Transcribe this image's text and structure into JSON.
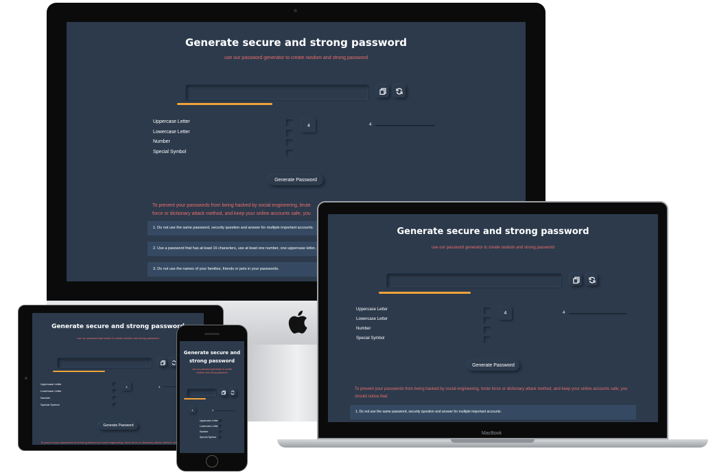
{
  "devices": {
    "imac": {
      "label": "iMac"
    },
    "macbook": {
      "label": "MacBook"
    },
    "ipad": {
      "label": "iPad"
    },
    "iphone": {
      "label": "iPhone"
    }
  },
  "app": {
    "title": "Generate secure and strong password",
    "subtitle": "use our password generator to create random and strong password",
    "password_value": "",
    "options": [
      {
        "label": "Uppercase Letter"
      },
      {
        "label": "Lowercase Letter"
      },
      {
        "label": "Number"
      },
      {
        "label": "Special Symbol"
      }
    ],
    "length_value": "4",
    "slider_value": "4",
    "generate_button": "Generate Password",
    "warning": "To prevent your passwords from being hacked by social engineering, brute force or dictionary attack method, and keep your online accounts safe, you should notice that:",
    "warning_imac": "To prevent your passwords from being hacked by social engineering, brute force or dictionary attack method, and keep your online accounts safe, you should notice that:",
    "tips": [
      "1. Do not use the same password, security question and answer for multiple important accounts.",
      "2. Use a password that has at least 16 characters, use at least one number, one uppercase letter, one lowercase letter and one special symbol.",
      "3. Do not use the names of your families, friends or pets in your passwords."
    ],
    "strength_fraction": 0.5
  },
  "colors": {
    "background": "#2c3a4c",
    "accent_text": "#ee6f6a",
    "strength_bar": "#f2a33a",
    "tip_bg": "#354a62"
  },
  "icons": [
    "copy-icon",
    "refresh-icon",
    "apple-logo-icon"
  ]
}
